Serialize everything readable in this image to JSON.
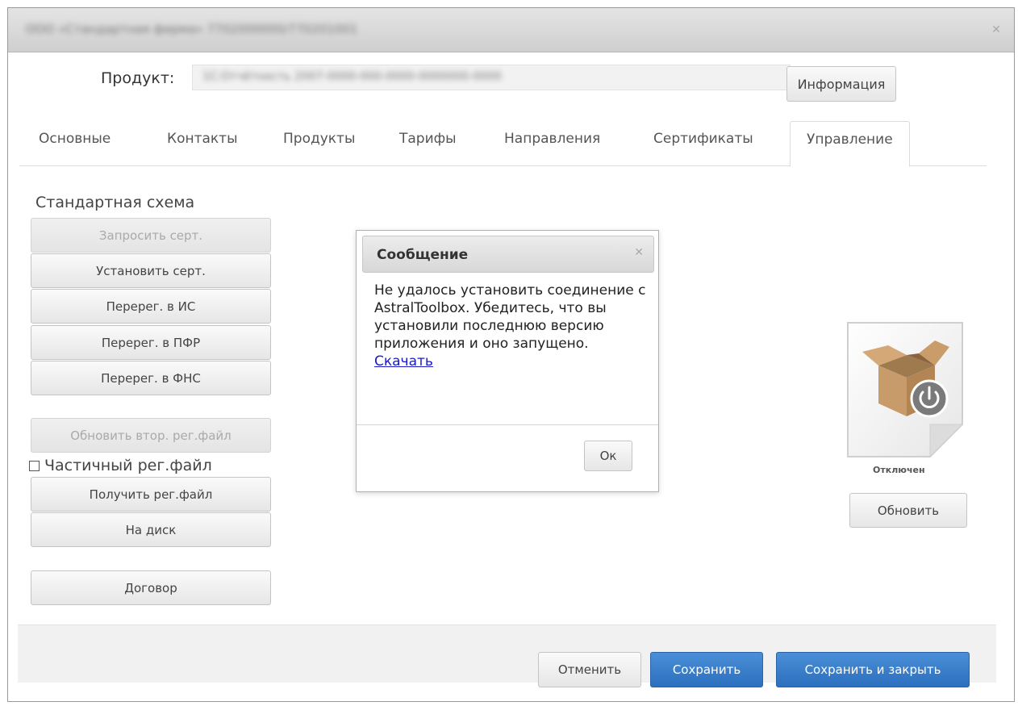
{
  "window": {
    "title_blurred": "ООО «Стандартная фирма» 7702000000/770201001",
    "close_glyph": "✕"
  },
  "product": {
    "label": "Продукт:",
    "value_blurred": "1С:Отчётность 2007-0000-000-0000-0000000-0000",
    "info_button": "Информация"
  },
  "tabs": [
    {
      "label": "Основные",
      "active": false
    },
    {
      "label": "Контакты",
      "active": false
    },
    {
      "label": "Продукты",
      "active": false
    },
    {
      "label": "Тарифы",
      "active": false
    },
    {
      "label": "Направления",
      "active": false
    },
    {
      "label": "Сертификаты",
      "active": false
    },
    {
      "label": "Управление",
      "active": true
    }
  ],
  "scheme": {
    "title": "Стандартная схема",
    "buttons": [
      {
        "label": "Запросить серт.",
        "enabled": false
      },
      {
        "label": "Установить серт.",
        "enabled": true
      },
      {
        "label": "Перерег. в ИС",
        "enabled": true
      },
      {
        "label": "Перерег. в ПФР",
        "enabled": true
      },
      {
        "label": "Перерег. в ФНС",
        "enabled": true
      },
      {
        "label": "Обновить втор. рег.файл",
        "enabled": false
      },
      {
        "label": "Получить рег.файл",
        "enabled": true
      },
      {
        "label": "На диск",
        "enabled": true
      },
      {
        "label": "Договор",
        "enabled": true
      }
    ],
    "partial_regfile_label": "Частичный рег.файл",
    "partial_regfile_checked": false
  },
  "dialog": {
    "title": "Сообщение",
    "close_glyph": "✕",
    "message": "Не удалось установить соединение с AstralToolbox. Убедитесь, что вы установили последнюю версию приложения и оно запущено.",
    "link_label": "Скачать",
    "ok_button": "Ок"
  },
  "status": {
    "icon": "box-power-icon",
    "label": "Отключен",
    "refresh_button": "Обновить"
  },
  "footer": {
    "cancel_button": "Отменить",
    "save_button": "Сохранить",
    "save_close_button": "Сохранить и закрыть"
  },
  "colors": {
    "primary": "#2b6fbf",
    "link": "#1a1ac8"
  }
}
